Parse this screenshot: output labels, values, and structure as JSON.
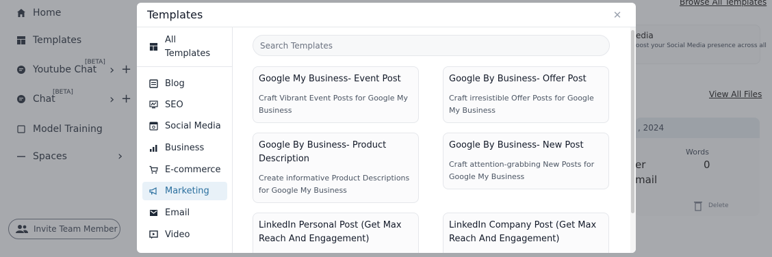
{
  "sidebar": {
    "items": [
      {
        "label": "Home",
        "icon": "home-icon"
      },
      {
        "label": "Templates",
        "icon": "templates-icon"
      },
      {
        "label": "Youtube Chat",
        "icon": "chat-icon",
        "beta": "[BETA]"
      },
      {
        "label": "Chat",
        "icon": "chat-icon",
        "beta": "[BETA]"
      },
      {
        "label": "Model Training",
        "icon": "model-icon"
      },
      {
        "label": "Spaces",
        "icon": "minus-icon"
      }
    ],
    "invite_label": "Invite Team Member"
  },
  "background": {
    "browse_all": "Browse All Templates",
    "card_title_partial": "edia",
    "card_desc_partial": "oost your Social Media presence across all",
    "view_all_files": "View All Files",
    "date_partial": ", 2024",
    "words_label": "Words",
    "words_value": "0",
    "er_partial": "er",
    "email_partial": "mail",
    "delete_label": "Delete"
  },
  "modal": {
    "title": "Templates",
    "close_glyph": "✕",
    "search_placeholder": "Search Templates",
    "all_label": "All Templates",
    "categories": [
      {
        "label": "Blog",
        "icon": "blog-icon"
      },
      {
        "label": "SEO",
        "icon": "seo-icon"
      },
      {
        "label": "Social Media",
        "icon": "social-media-icon"
      },
      {
        "label": "Business",
        "icon": "business-icon"
      },
      {
        "label": "E-commerce",
        "icon": "cart-icon"
      },
      {
        "label": "Marketing",
        "icon": "megaphone-icon",
        "active": true
      },
      {
        "label": "Email",
        "icon": "email-icon"
      },
      {
        "label": "Video",
        "icon": "video-icon"
      }
    ],
    "templates": [
      {
        "title": "Google My Business- Event Post",
        "desc": "Craft Vibrant Event Posts for Google My Business"
      },
      {
        "title": "Google By Business- Offer Post",
        "desc": "Craft irresistible Offer Posts for Google My Business"
      },
      {
        "title": "Google By Business- Product Description",
        "desc": "Create informative Product Descriptions for Google My Business"
      },
      {
        "title": "Google By Business- New Post",
        "desc": "Craft attention-grabbing New Posts for Google My Business"
      },
      {
        "title": "LinkedIn Personal Post (Get Max Reach And Engagement)",
        "desc": ""
      },
      {
        "title": "LinkedIn Company Post (Get Max Reach And Engagement)",
        "desc": ""
      }
    ]
  },
  "colors": {
    "accent": "#2a6f9e",
    "active_bg": "#e8f1f8"
  }
}
